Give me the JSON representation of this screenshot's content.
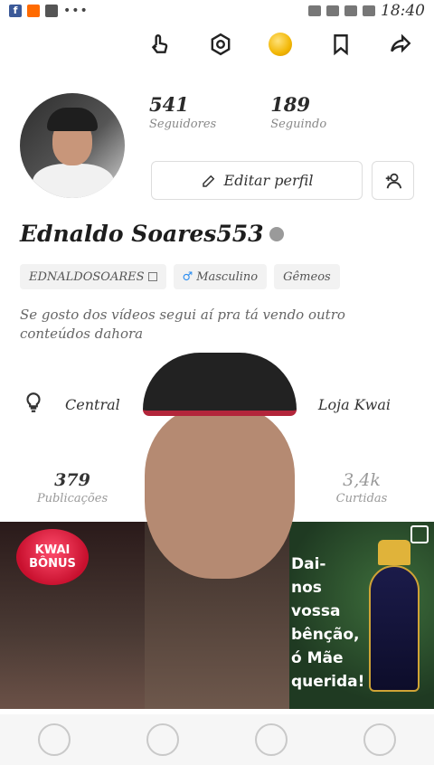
{
  "status_bar": {
    "time": "18:40",
    "icons": [
      "facebook-icon",
      "kwai-icon",
      "folder-icon",
      "more-icon",
      "alarm-icon",
      "wifi-icon",
      "sim-icon",
      "battery-icon"
    ]
  },
  "top_actions": {
    "icons": [
      "touch-icon",
      "settings-icon",
      "coin-icon",
      "bookmark-icon",
      "share-icon"
    ]
  },
  "profile": {
    "followers_count": "541",
    "followers_label": "Seguidores",
    "following_count": "189",
    "following_label": "Seguindo",
    "edit_label": "Editar perfil",
    "username": "Ednaldo Soares553",
    "tags": {
      "id": "EDNALDOSOARES",
      "gender": "Masculino",
      "sign": "Gêmeos"
    },
    "bio": "Se gosto dos vídeos segui aí pra tá vendo outro conteúdos dahora"
  },
  "quick_row": {
    "central_label": "Central",
    "store_label": "Loja Kwai"
  },
  "tab_stats": {
    "posts_count": "379",
    "posts_label": "Publicações",
    "likes_count": "3,4k",
    "likes_label": "Curtidas"
  },
  "grid": {
    "badge_line1": "KWAI",
    "badge_line2": "BÔNUS",
    "prayer_text": "Dai-nos vossa bênção, ó Mãe querida!"
  },
  "colors": {
    "accent": "#ff6a00",
    "male": "#2a8cf0"
  }
}
